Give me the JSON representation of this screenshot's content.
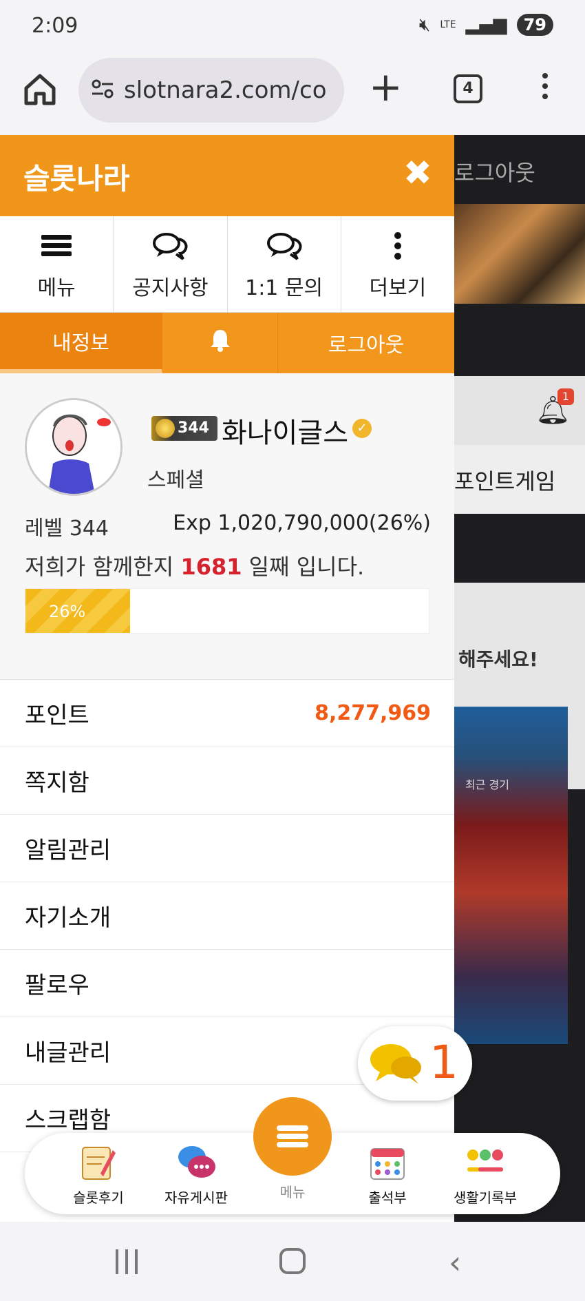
{
  "status_bar": {
    "time": "2:09",
    "network": "LTE",
    "battery": "79"
  },
  "browser": {
    "url": "slotnara2.com/co",
    "tab_count": "4"
  },
  "background_page": {
    "logout": "로그아웃",
    "notification_count": "1",
    "point_game": "포인트게임",
    "notice_fragment": "해주세요!",
    "recent_games_label": "최근 경기"
  },
  "drawer": {
    "title": "슬롯나라",
    "quick_menu": [
      {
        "label": "메뉴",
        "icon": "menu-icon"
      },
      {
        "label": "공지사항",
        "icon": "chat-bubbles-icon"
      },
      {
        "label": "1:1 문의",
        "icon": "chat-bubbles-icon"
      },
      {
        "label": "더보기",
        "icon": "more-vertical-icon"
      }
    ],
    "tabs": {
      "my_info": "내정보",
      "logout": "로그아웃"
    },
    "profile": {
      "level_badge": "344",
      "nickname": "화나이글스",
      "grade": "스페셜",
      "level_label": "레벨 344",
      "exp": "Exp 1,020,790,000(26%)",
      "days_prefix": "저희가 함께한지",
      "days": "1681",
      "days_suffix": "일째 입니다.",
      "progress_percent": 26,
      "progress_label": "26%"
    },
    "menu": [
      {
        "label": "포인트",
        "value": "8,277,969"
      },
      {
        "label": "쪽지함"
      },
      {
        "label": "알림관리"
      },
      {
        "label": "자기소개"
      },
      {
        "label": "팔로우"
      },
      {
        "label": "내글관리"
      },
      {
        "label": "스크랩함"
      }
    ]
  },
  "chat_float": {
    "count": "1"
  },
  "dock": {
    "items": [
      "슬롯후기",
      "자유게시판",
      "메뉴",
      "출석부",
      "생활기록부"
    ]
  },
  "colors": {
    "accent": "#f0961b",
    "points": "#f05a14",
    "days": "#d6222c"
  }
}
